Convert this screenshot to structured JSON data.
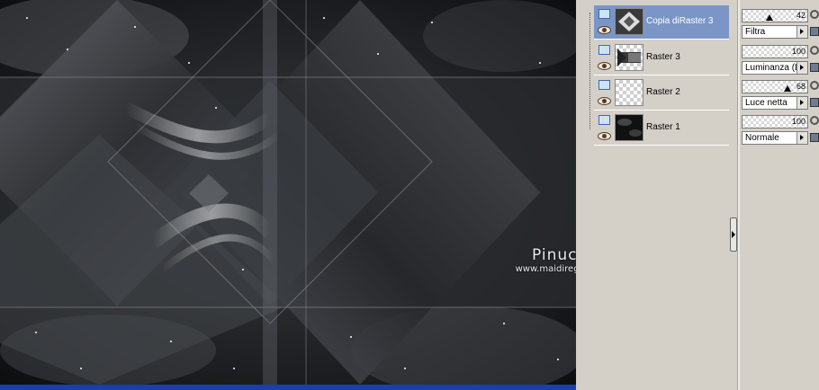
{
  "canvas": {
    "watermark": {
      "name": "Pinuccia",
      "url": "www.maidiregrafica.eu"
    }
  },
  "layers": [
    {
      "name": "Copia diRaster 3",
      "selected": true,
      "thumb": "diamond-art"
    },
    {
      "name": "Raster 3",
      "selected": false,
      "thumb": "checker-art"
    },
    {
      "name": "Raster 2",
      "selected": false,
      "thumb": "checker"
    },
    {
      "name": "Raster 1",
      "selected": false,
      "thumb": "space-dark"
    }
  ],
  "properties": [
    {
      "opacity": "42",
      "blend": "Filtra"
    },
    {
      "opacity": "100",
      "blend": "Luminanza (L)"
    },
    {
      "opacity": "68",
      "blend": "Luce netta"
    },
    {
      "opacity": "100",
      "blend": "Normale"
    }
  ],
  "icons": {
    "layer": "raster-layer-icon",
    "visibility": "eye-icon",
    "link": "link-icon",
    "lock": "lock-icon",
    "dropdown": "dropdown-arrow-icon",
    "collapse": "collapse-arrow-icon"
  },
  "colors": {
    "selection": "#7b96c6",
    "panel": "#d4d0c8",
    "canvas_bottom_bar": "#1c3fa6"
  }
}
